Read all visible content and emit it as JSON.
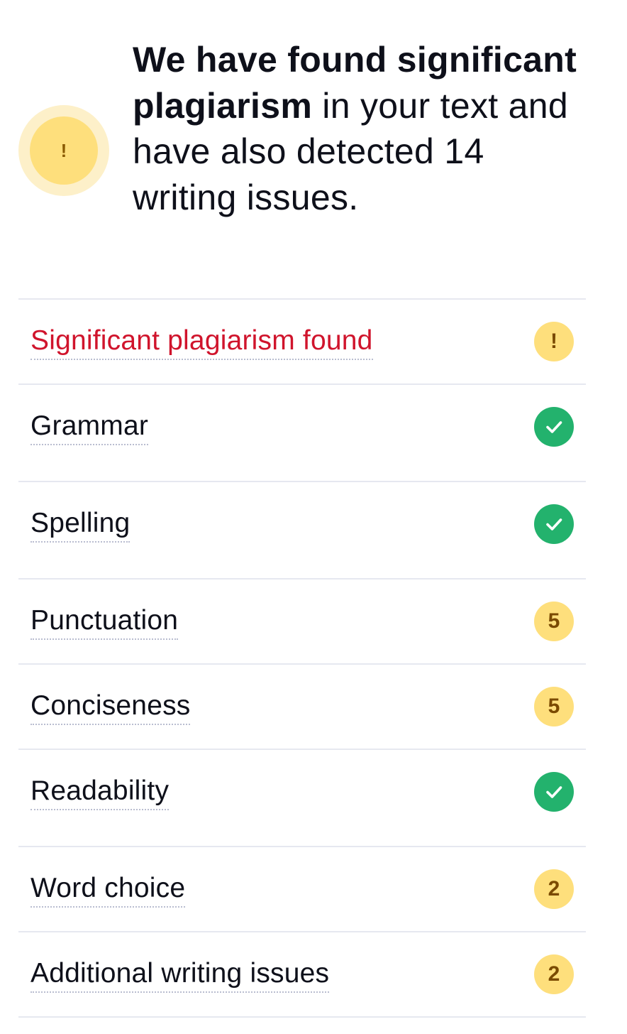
{
  "summary": {
    "headline_bold": "We have found significant plagiarism",
    "headline_rest": " in your text and have also detected 14 writing issues.",
    "badge_symbol": "!",
    "badge_icon": "exclamation-icon",
    "badge_color": "#fedf7c"
  },
  "issues": [
    {
      "label": "Significant plagiarism found",
      "status": "warning",
      "indicator": "!",
      "icon": "exclamation-icon"
    },
    {
      "label": "Grammar",
      "status": "ok",
      "icon": "check-icon"
    },
    {
      "label": "Spelling",
      "status": "ok",
      "icon": "check-icon"
    },
    {
      "label": "Punctuation",
      "status": "count",
      "indicator": "5"
    },
    {
      "label": "Conciseness",
      "status": "count",
      "indicator": "5"
    },
    {
      "label": "Readability",
      "status": "ok",
      "icon": "check-icon"
    },
    {
      "label": "Word choice",
      "status": "count",
      "indicator": "2"
    },
    {
      "label": "Additional writing issues",
      "status": "count",
      "indicator": "2"
    }
  ],
  "colors": {
    "danger_text": "#d0142c",
    "ok_green": "#23b26d",
    "count_yellow": "#fedf7c",
    "divider": "#e6e8f0"
  }
}
